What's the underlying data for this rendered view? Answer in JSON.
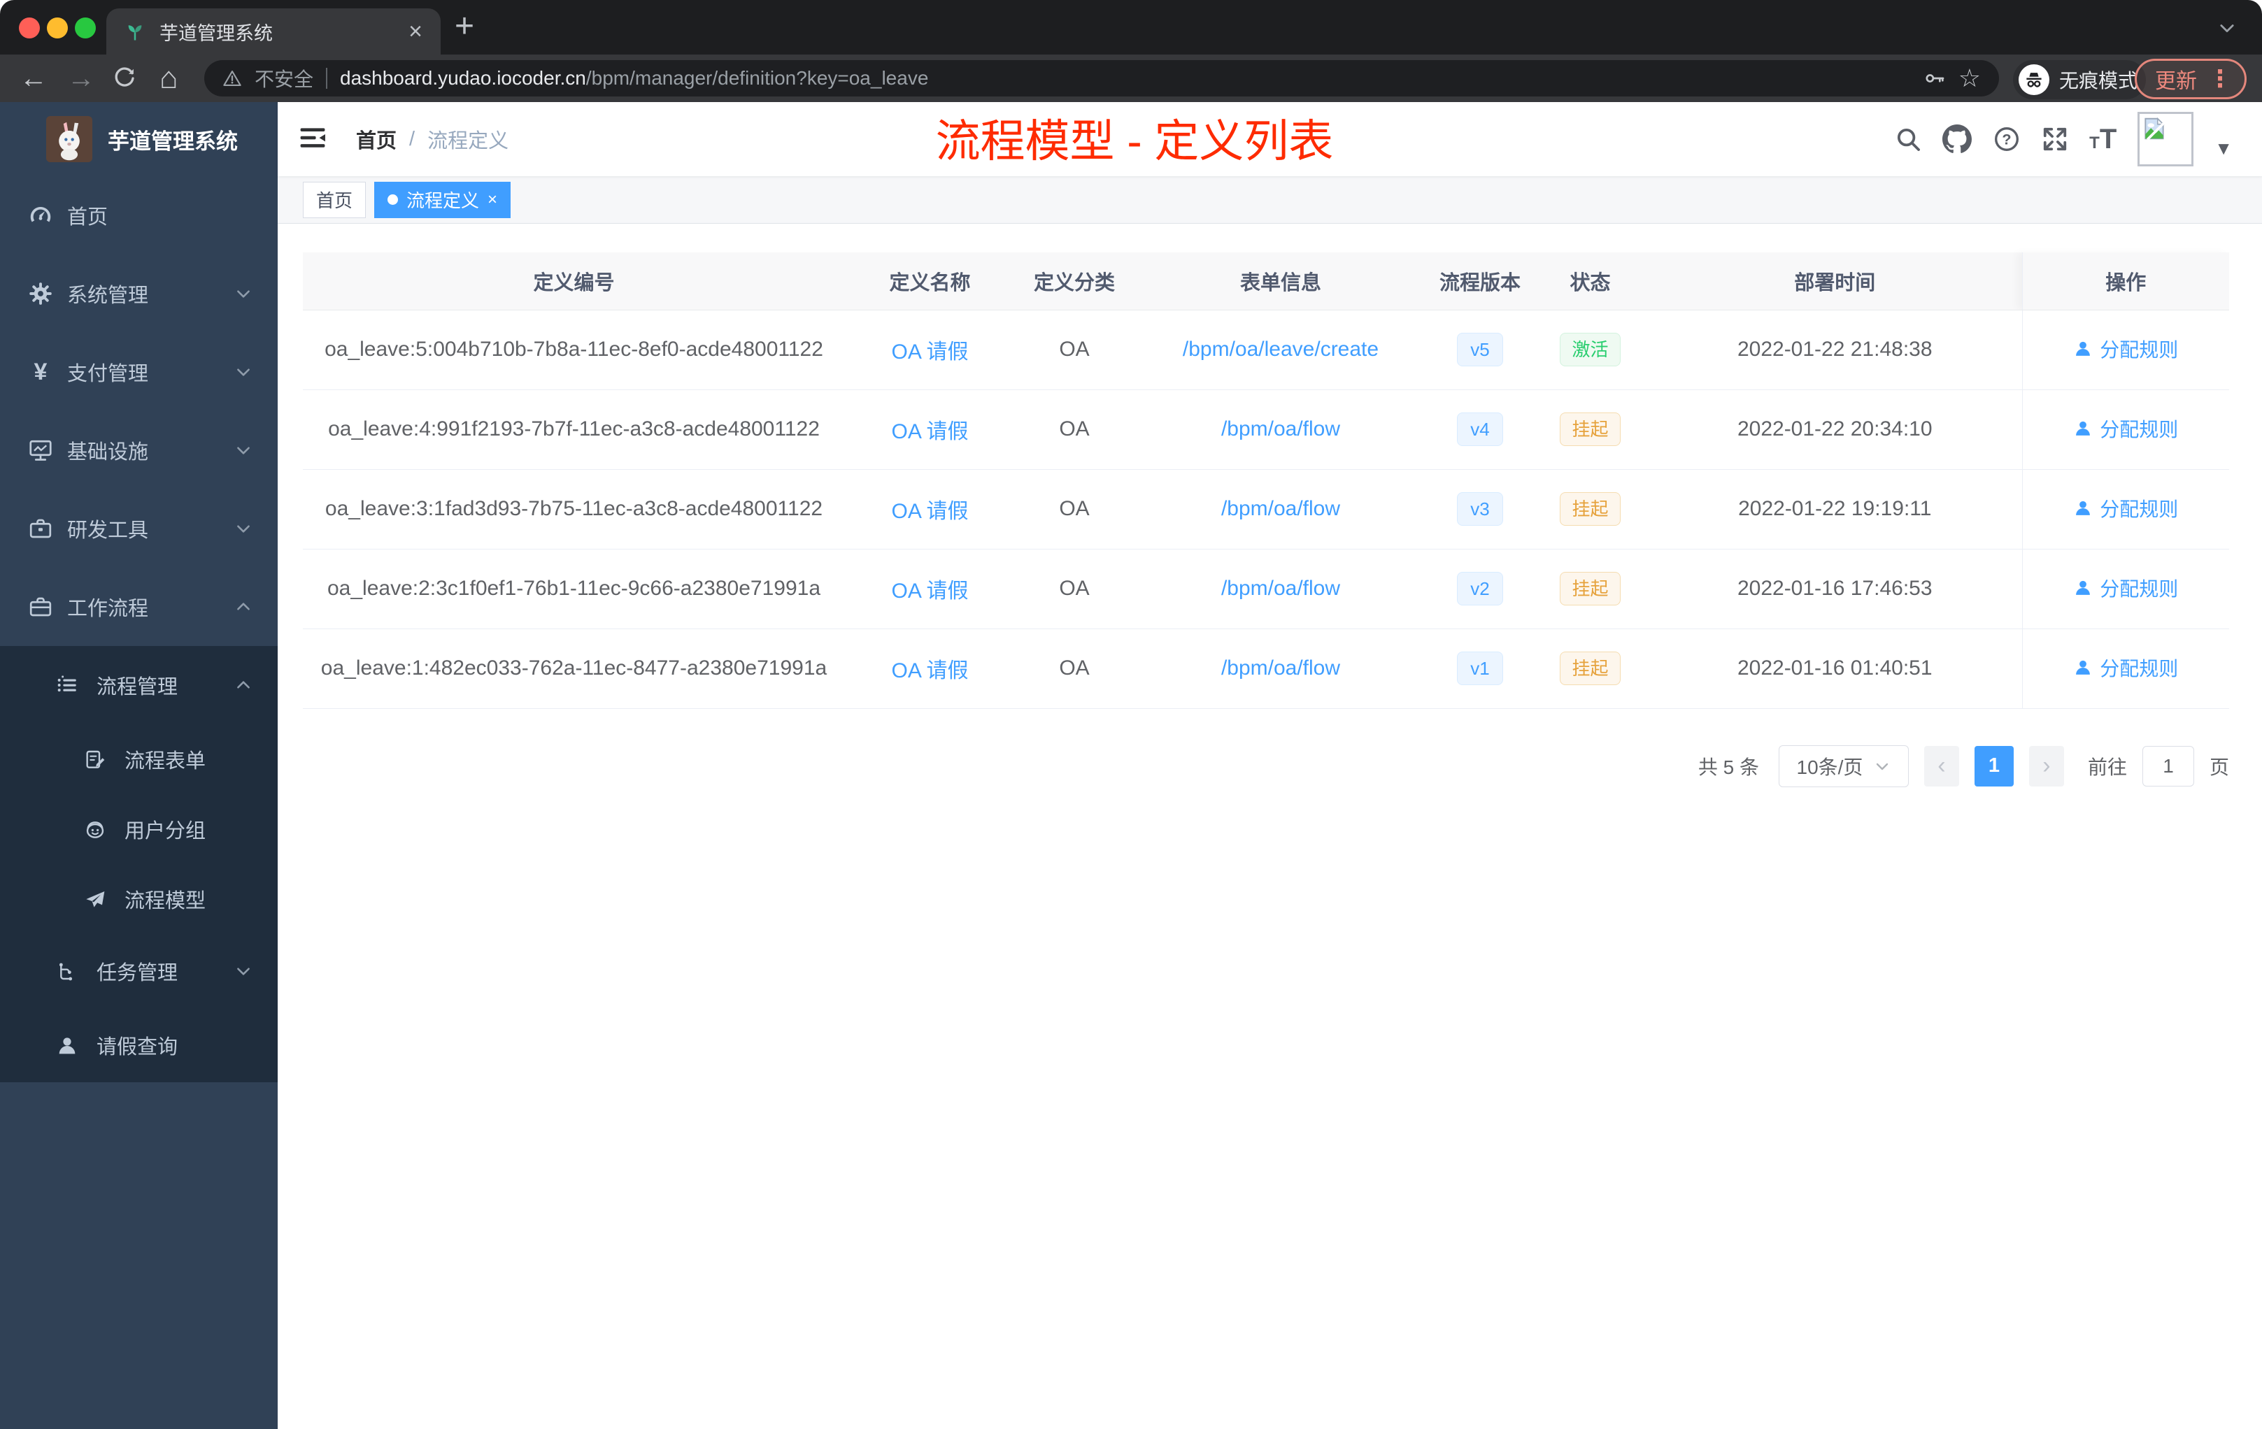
{
  "colors": {
    "accent": "#409eff",
    "success": "#29ce6f",
    "warning": "#e6a23c",
    "annotation_red": "#fe2b00",
    "sidebar_bg": "#304156",
    "submenu_bg": "#1f2d3d"
  },
  "browser": {
    "tab_title": "芋道管理系统",
    "security_label": "不安全",
    "url_host": "dashboard.yudao.iocoder.cn",
    "url_path": "/bpm/manager/definition?key=oa_leave",
    "incognito_label": "无痕模式",
    "update_label": "更新"
  },
  "glyphs": {
    "close": "×",
    "new_tab": "+",
    "caret_down": "▼",
    "prev": "‹",
    "next": "›",
    "more_v": "⋮",
    "star": "☆",
    "back": "←",
    "forward": "→",
    "home": "⌂",
    "yen": "¥",
    "slash": "/",
    "font_small": "T",
    "font_big": "T"
  },
  "sidebar": {
    "logo_title": "芋道管理系统",
    "items": [
      {
        "label": "首页"
      },
      {
        "label": "系统管理"
      },
      {
        "label": "支付管理"
      },
      {
        "label": "基础设施"
      },
      {
        "label": "研发工具"
      },
      {
        "label": "工作流程"
      },
      {
        "label": "流程管理"
      },
      {
        "label": "流程表单"
      },
      {
        "label": "用户分组"
      },
      {
        "label": "流程模型"
      },
      {
        "label": "任务管理"
      },
      {
        "label": "请假查询"
      }
    ]
  },
  "navbar": {
    "breadcrumb_home": "首页",
    "breadcrumb_sep": "/",
    "breadcrumb_current": "流程定义",
    "annotation": "流程模型 - 定义列表"
  },
  "tags": {
    "home": "首页",
    "active": "流程定义"
  },
  "table": {
    "columns": [
      "定义编号",
      "定义名称",
      "定义分类",
      "表单信息",
      "流程版本",
      "状态",
      "部署时间",
      "操作"
    ],
    "rows": [
      {
        "id": "oa_leave:5:004b710b-7b8a-11ec-8ef0-acde48001122",
        "name": "OA 请假",
        "category": "OA",
        "form": "/bpm/oa/leave/create",
        "version": "v5",
        "status": "激活",
        "status_type": "success",
        "time": "2022-01-22 21:48:38",
        "action": "分配规则"
      },
      {
        "id": "oa_leave:4:991f2193-7b7f-11ec-a3c8-acde48001122",
        "name": "OA 请假",
        "category": "OA",
        "form": "/bpm/oa/flow",
        "version": "v4",
        "status": "挂起",
        "status_type": "warning",
        "time": "2022-01-22 20:34:10",
        "action": "分配规则"
      },
      {
        "id": "oa_leave:3:1fad3d93-7b75-11ec-a3c8-acde48001122",
        "name": "OA 请假",
        "category": "OA",
        "form": "/bpm/oa/flow",
        "version": "v3",
        "status": "挂起",
        "status_type": "warning",
        "time": "2022-01-22 19:19:11",
        "action": "分配规则"
      },
      {
        "id": "oa_leave:2:3c1f0ef1-76b1-11ec-9c66-a2380e71991a",
        "name": "OA 请假",
        "category": "OA",
        "form": "/bpm/oa/flow",
        "version": "v2",
        "status": "挂起",
        "status_type": "warning",
        "time": "2022-01-16 17:46:53",
        "action": "分配规则"
      },
      {
        "id": "oa_leave:1:482ec033-762a-11ec-8477-a2380e71991a",
        "name": "OA 请假",
        "category": "OA",
        "form": "/bpm/oa/flow",
        "version": "v1",
        "status": "挂起",
        "status_type": "warning",
        "time": "2022-01-16 01:40:51",
        "action": "分配规则"
      }
    ]
  },
  "pagination": {
    "total": "共 5 条",
    "page_size": "10条/页",
    "current_page": "1",
    "goto_label": "前往",
    "goto_value": "1",
    "page_unit": "页"
  }
}
